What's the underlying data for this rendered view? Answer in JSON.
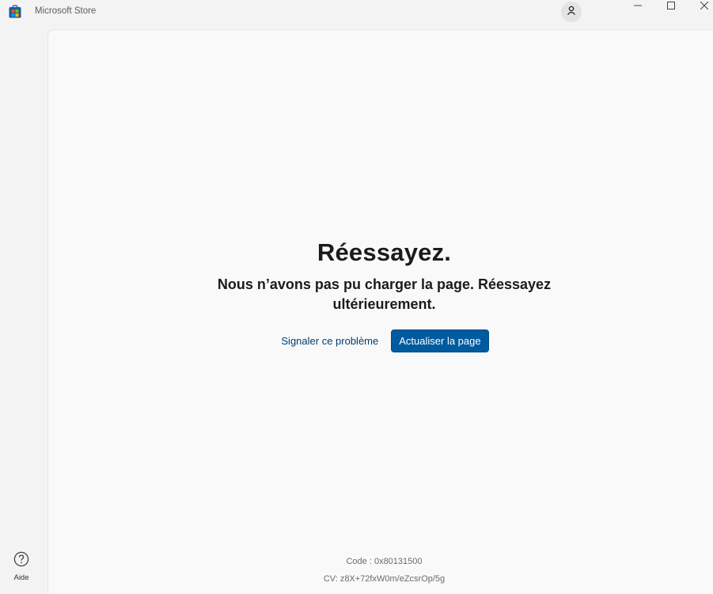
{
  "titlebar": {
    "app_title": "Microsoft Store",
    "icons": {
      "app": "microsoft-store-icon",
      "account": "user-icon",
      "minimize": "minimize-icon",
      "maximize": "maximize-icon",
      "close": "close-icon"
    }
  },
  "rail": {
    "help_label": "Aide",
    "help_icon": "help-circle-icon"
  },
  "error": {
    "title": "Réessayez.",
    "message": "Nous n’avons pas pu charger la page. Réessayez ultérieurement.",
    "report_label": "Signaler ce problème",
    "refresh_label": "Actualiser la page"
  },
  "diagnostics": {
    "code": "Code : 0x80131500",
    "cv": "CV: z8X+72fxW0m/eZcsrOp/5g"
  },
  "colors": {
    "accent": "#005a9e",
    "link": "#003e73",
    "background": "#f3f3f3",
    "panel": "#f9f9f9"
  }
}
